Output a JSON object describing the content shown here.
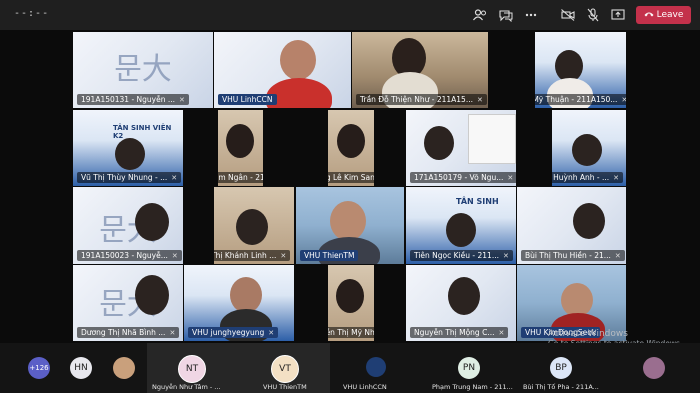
{
  "topbar": {
    "timer": "--:--",
    "icons": [
      "people-icon",
      "chat-icon",
      "more-icon",
      "camera-off-icon",
      "mic-off-icon",
      "share-icon"
    ],
    "leave_label": "Leave"
  },
  "tiles": [
    {
      "name": "191A150131 - Nguyễn ..."
    },
    {
      "name": "VHU LinhCCN"
    },
    {
      "name": "Trần Đỗ Thiện Như - 211A15..."
    },
    {
      "name": "Nguyễn Mỹ Thuận - 211A150..."
    },
    {
      "name": "Vũ Thị Thùy Nhung - ..."
    },
    {
      "name": "Ngô Kim Ngân - 211..."
    },
    {
      "name": "Dương Lê Kim Sang - ..."
    },
    {
      "name": "171A150179 - Võ Ngu..."
    },
    {
      "name": "Ngô Thị Huỳnh Anh - ..."
    },
    {
      "name": "191A150023 - Nguyễ..."
    },
    {
      "name": "Tống Thị Khánh Linh ..."
    },
    {
      "name": "VHU ThienTM"
    },
    {
      "name": "Tiên Ngọc Kiều - 211..."
    },
    {
      "name": "Bùi Thị Thu Hiền - 21..."
    },
    {
      "name": "Dương Thị Nhã Bình ..."
    },
    {
      "name": "VHU junghyegyung"
    },
    {
      "name": "Nguyễn Thị Mỹ Nhiê..."
    },
    {
      "name": "Nguyễn Thị Mộng C..."
    },
    {
      "name": "VHU KimDongSeok"
    }
  ],
  "banner_text": {
    "tan_sinh_vien": "TÂN SINH VIÊN K2",
    "tan_sinh": "TÂN SINH",
    "chinese": "문大",
    "small_title": "TỌA ĐÀM HỘI NHẬP",
    "year": "NĂM HỌC 2021 - 2022",
    "dai_hoc": "ĐẠI HỌC"
  },
  "bottombar": {
    "overflow_count": "+126",
    "avatars": [
      {
        "initials": "HN",
        "name": ""
      },
      {
        "initials": "",
        "name": ""
      },
      {
        "initials": "NT",
        "name": "Nguyễn Như Tâm - ..."
      },
      {
        "initials": "VT",
        "name": "VHU ThienTM"
      },
      {
        "initials": "",
        "name": "VHU LinhCCN"
      },
      {
        "initials": "PN",
        "name": "Phạm Trung Nam - 211..."
      },
      {
        "initials": "BP",
        "name": "Bùi Thị Tố Pha - 211A..."
      },
      {
        "initials": "",
        "name": ""
      }
    ]
  },
  "activate_windows": {
    "line1": "Activate Windows",
    "line2": "Go to Settings to activate Windows."
  },
  "colors": {
    "leave": "#c4314b",
    "topbar": "#1f1f1f",
    "bottombar": "#141414"
  }
}
